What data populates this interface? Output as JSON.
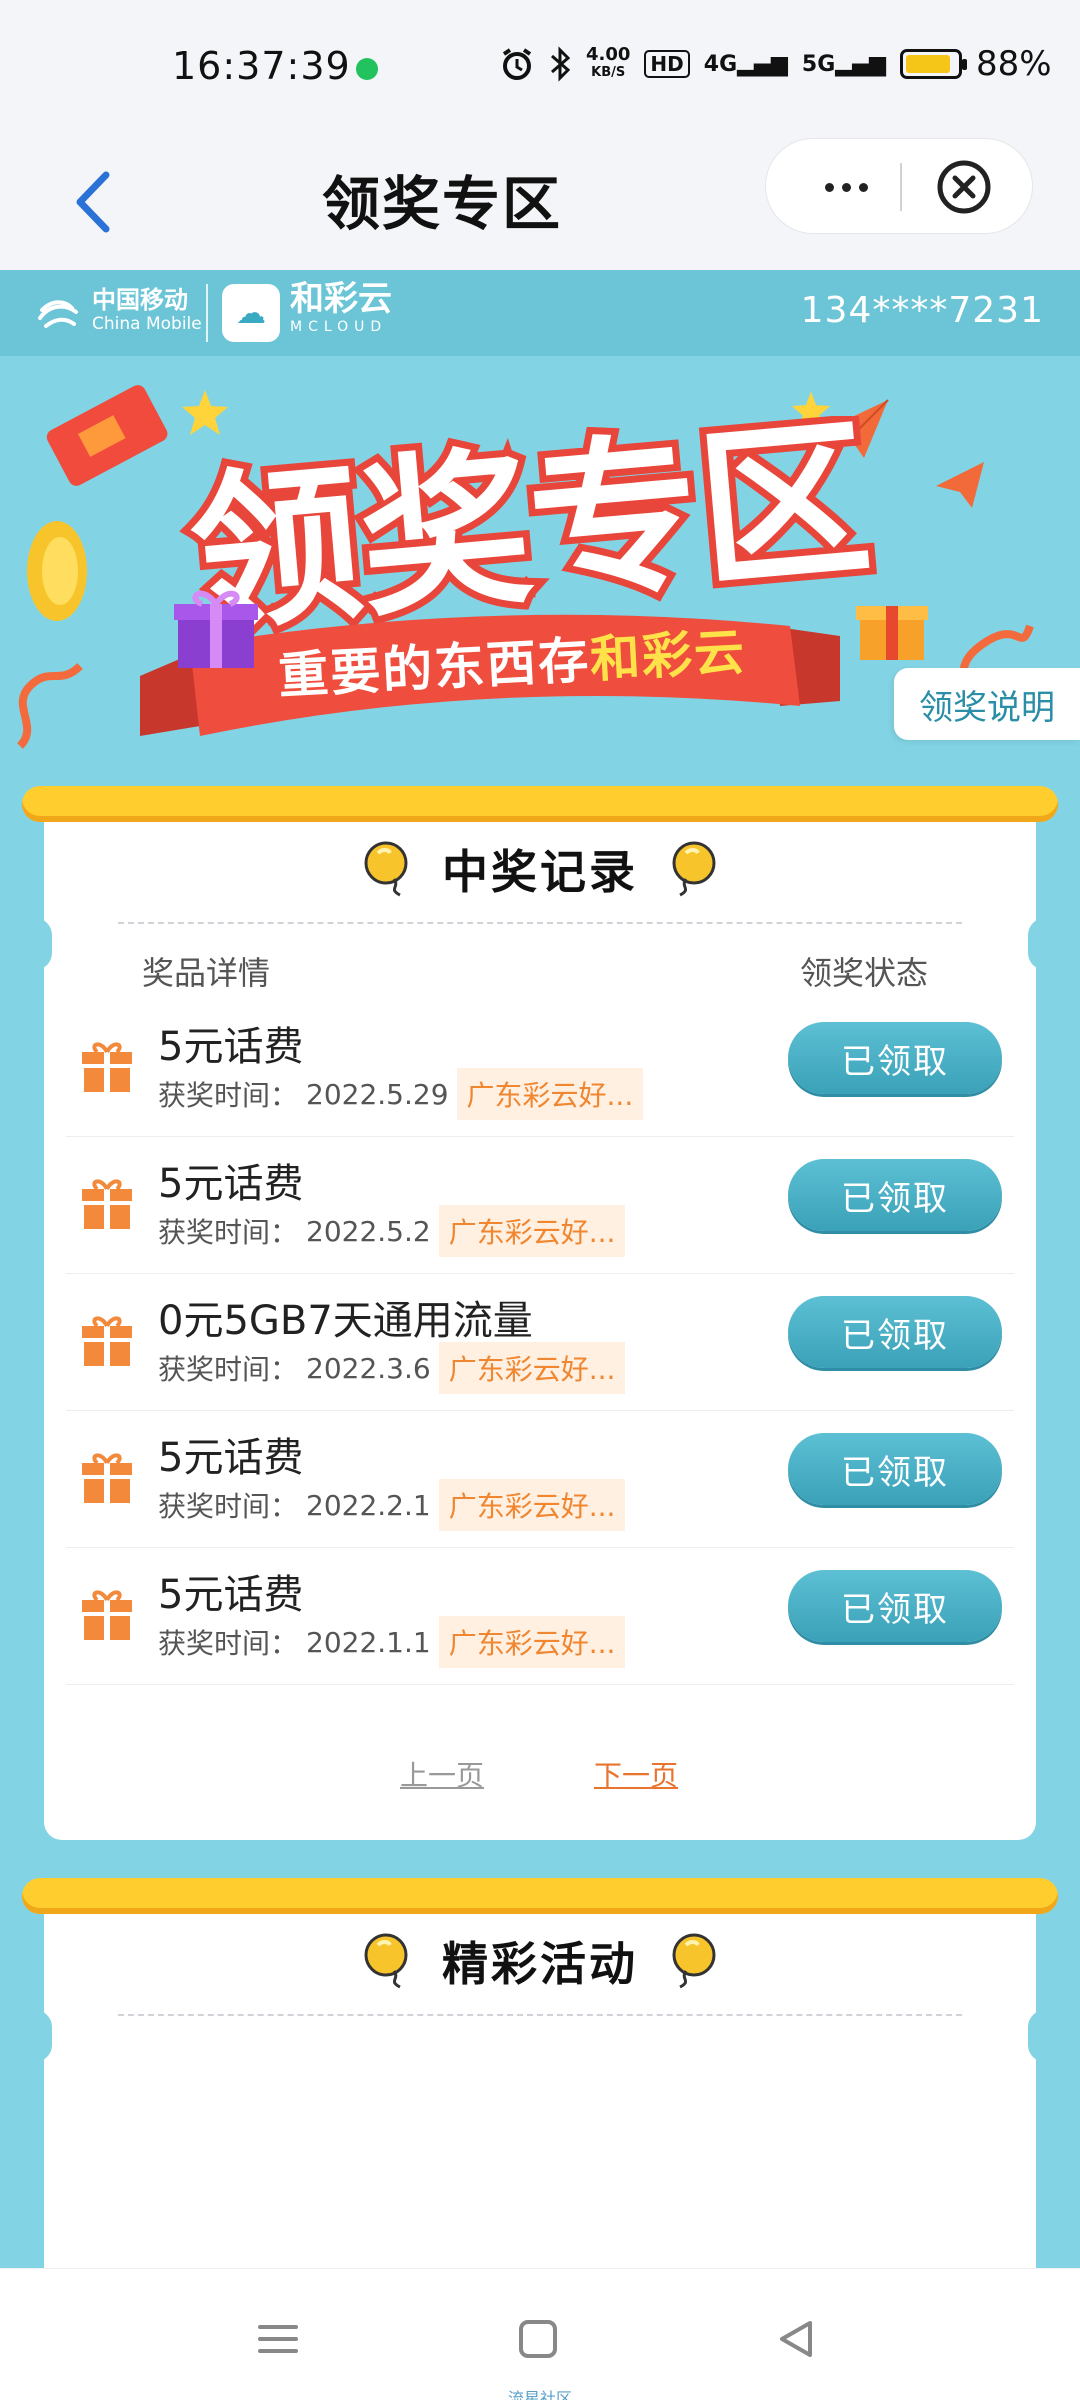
{
  "status_bar": {
    "time": "16:37:39",
    "net_speed_value": "4.00",
    "net_speed_unit": "KB/S",
    "hd": "HD",
    "sig1": "4G",
    "sig2": "5G",
    "battery_pct": "88%",
    "battery_level": 0.88
  },
  "titlebar": {
    "title": "领奖专区"
  },
  "brand": {
    "cm_zh": "中国移动",
    "cm_en": "China Mobile",
    "mc_zh": "和彩云",
    "mc_en": "MCLOUD",
    "phone": "134****7231"
  },
  "banner": {
    "ribbon_prefix": "重要的东西存",
    "ribbon_highlight": "和彩云",
    "rules_label": "领奖说明"
  },
  "records": {
    "title": "中奖记录",
    "col_detail": "奖品详情",
    "col_status": "领奖状态",
    "items": [
      {
        "name": "5元话费",
        "date_label": "获奖时间：",
        "date": "2022.5.29",
        "tag": "广东彩云好...",
        "status": "已领取"
      },
      {
        "name": "5元话费",
        "date_label": "获奖时间：",
        "date": "2022.5.2",
        "tag": "广东彩云好...",
        "status": "已领取"
      },
      {
        "name": "0元5GB7天通用流量",
        "date_label": "获奖时间：",
        "date": "2022.3.6",
        "tag": "广东彩云好...",
        "status": "已领取"
      },
      {
        "name": "5元话费",
        "date_label": "获奖时间：",
        "date": "2022.2.1",
        "tag": "广东彩云好...",
        "status": "已领取"
      },
      {
        "name": "5元话费",
        "date_label": "获奖时间：",
        "date": "2022.1.1",
        "tag": "广东彩云好...",
        "status": "已领取"
      }
    ],
    "prev": "上一页",
    "next": "下一页"
  },
  "activities": {
    "title": "精彩活动"
  },
  "nav": {
    "watermark": "流星社区"
  },
  "colors": {
    "page_bg": "#82d4e4",
    "accent_yellow": "#ffcd2e",
    "button_teal": "#3aa1b8",
    "tag_orange": "#f0862f"
  },
  "icons": [
    "back-arrow-icon",
    "more-dots-icon",
    "close-circle-icon",
    "gift-icon",
    "balloon-icon",
    "menu-icon",
    "home-square-icon",
    "back-triangle-icon"
  ]
}
